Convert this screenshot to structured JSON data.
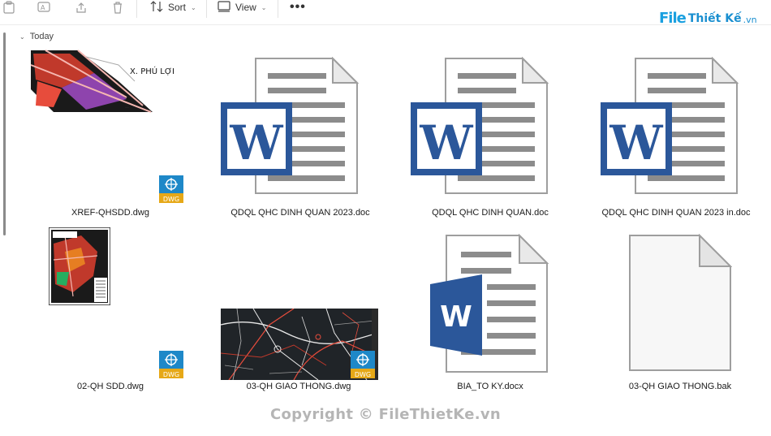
{
  "toolbar": {
    "sort_label": "Sort",
    "view_label": "View",
    "more_label": "•••"
  },
  "brand": {
    "file": "File",
    "rest": "Thiết Kế",
    "vn": ".vn"
  },
  "group": {
    "label": "Today"
  },
  "files": [
    {
      "name": "XREF-QHSDD.dwg",
      "type": "dwg",
      "thumb_text": "X. PHÚ LỢI"
    },
    {
      "name": "QDQL QHC DINH QUAN 2023.doc",
      "type": "doc"
    },
    {
      "name": "QDQL QHC DINH QUAN.doc",
      "type": "doc"
    },
    {
      "name": "QDQL QHC DINH QUAN 2023 in.doc",
      "type": "doc"
    },
    {
      "name": "02-QH SDD.dwg",
      "type": "dwg"
    },
    {
      "name": "03-QH GIAO THONG.dwg",
      "type": "dwg"
    },
    {
      "name": "BIA_TO KY.docx",
      "type": "docx"
    },
    {
      "name": "03-QH GIAO THONG.bak",
      "type": "bak"
    }
  ],
  "badge_text": "DWG",
  "word_letter": "W",
  "watermark": "Copyright © FileThietKe.vn",
  "colors": {
    "word_blue": "#2b579a",
    "dwg_blue": "#1e88c8",
    "dwg_yellow": "#e6a817",
    "accent": "#1aa0e0"
  }
}
